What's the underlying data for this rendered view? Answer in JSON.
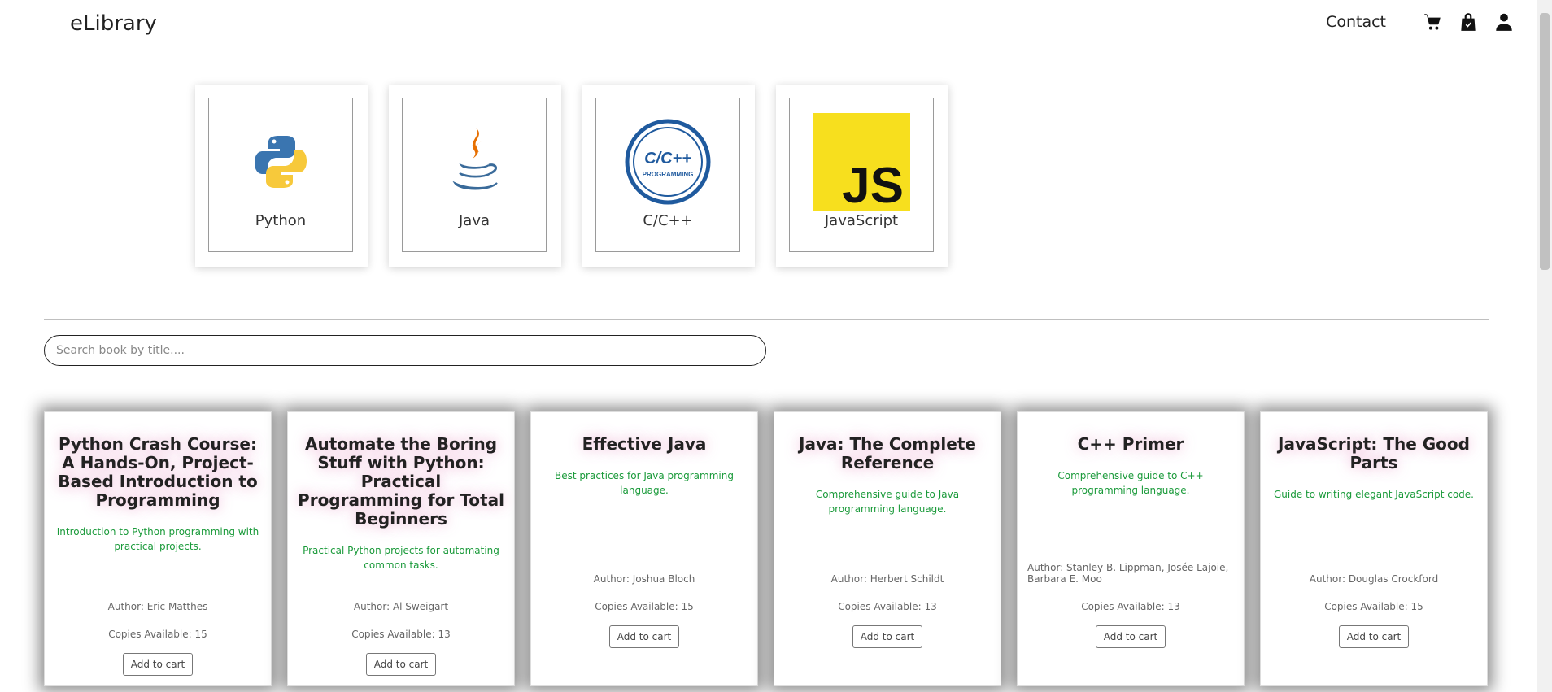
{
  "nav": {
    "brand": "eLibrary",
    "contact_label": "Contact",
    "icons": [
      "cart-icon",
      "shopping-bag-icon",
      "user-icon"
    ]
  },
  "categories": [
    {
      "label": "Python",
      "icon": "python-logo"
    },
    {
      "label": "Java",
      "icon": "java-logo"
    },
    {
      "label": "C/C++",
      "icon": "cpp-programming-logo"
    },
    {
      "label": "JavaScript",
      "icon": "javascript-logo"
    }
  ],
  "logo_text": {
    "cpp_main": "C/C++",
    "cpp_sub": "PROGRAMMING",
    "js": "JS"
  },
  "search": {
    "placeholder": "Search book by title...."
  },
  "books": [
    {
      "title": "Python Crash Course: A Hands-On, Project-Based Introduction to Programming",
      "description": "Introduction to Python programming with practical projects.",
      "author": "Author: Eric Matthes",
      "copies": "Copies Available: 15",
      "button": "Add to cart"
    },
    {
      "title": "Automate the Boring Stuff with Python: Practical Programming for Total Beginners",
      "description": "Practical Python projects for automating common tasks.",
      "author": "Author: Al Sweigart",
      "copies": "Copies Available: 13",
      "button": "Add to cart"
    },
    {
      "title": "Effective Java",
      "description": "Best practices for Java programming language.",
      "author": "Author: Joshua Bloch",
      "copies": "Copies Available: 15",
      "button": "Add to cart"
    },
    {
      "title": "Java: The Complete Reference",
      "description": "Comprehensive guide to Java programming language.",
      "author": "Author: Herbert Schildt",
      "copies": "Copies Available: 13",
      "button": "Add to cart"
    },
    {
      "title": "C++ Primer",
      "description": "Comprehensive guide to C++ programming language.",
      "author": "Author: Stanley B. Lippman, Josée Lajoie, Barbara E. Moo",
      "copies": "Copies Available: 13",
      "button": "Add to cart"
    },
    {
      "title": "JavaScript: The Good Parts",
      "description": "Guide to writing elegant JavaScript code.",
      "author": "Author: Douglas Crockford",
      "copies": "Copies Available: 15",
      "button": "Add to cart"
    }
  ],
  "colors": {
    "description_green": "#1a9a3a",
    "js_yellow": "#f7df1e",
    "cpp_blue": "#1f5a9e"
  }
}
